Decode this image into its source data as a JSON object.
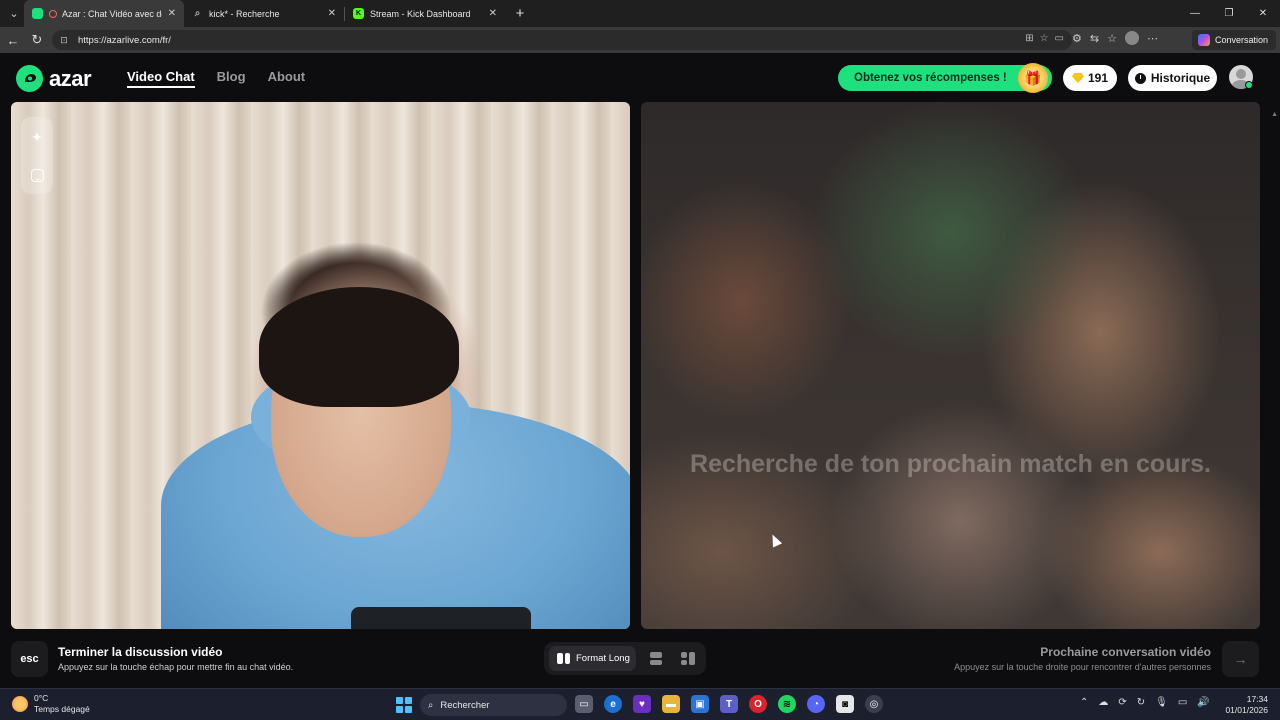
{
  "browser": {
    "tabs": [
      {
        "title": "Azar : Chat Vidéo avec de no",
        "active": true
      },
      {
        "title": "kick* - Recherche",
        "active": false
      },
      {
        "title": "Stream - Kick Dashboard",
        "active": false
      }
    ],
    "url": "https://azarlive.com/fr/",
    "copilot_label": "Conversation"
  },
  "site": {
    "logo_text": "azar",
    "nav": {
      "video_chat": "Video Chat",
      "blog": "Blog",
      "about": "About"
    },
    "rewards_label": "Obtenez vos récompenses !",
    "gems_count": "191",
    "history_label": "Historique",
    "accent_color": "#1ee07f"
  },
  "remote": {
    "status_text": "Recherche de ton prochain match en cours."
  },
  "controls": {
    "esc_key": "esc",
    "end_title": "Terminer la discussion vidéo",
    "end_subtitle": "Appuyez sur la touche échap pour mettre fin au chat vidéo.",
    "format_long_label": "Format Long",
    "next_title": "Prochaine conversation vidéo",
    "next_subtitle": "Appuyez sur la touche droite pour rencontrer d'autres personnes"
  },
  "taskbar": {
    "weather_temp": "0°C",
    "weather_desc": "Temps dégagé",
    "search_placeholder": "Rechercher",
    "time": "17:34",
    "date": "01/01/2026"
  }
}
